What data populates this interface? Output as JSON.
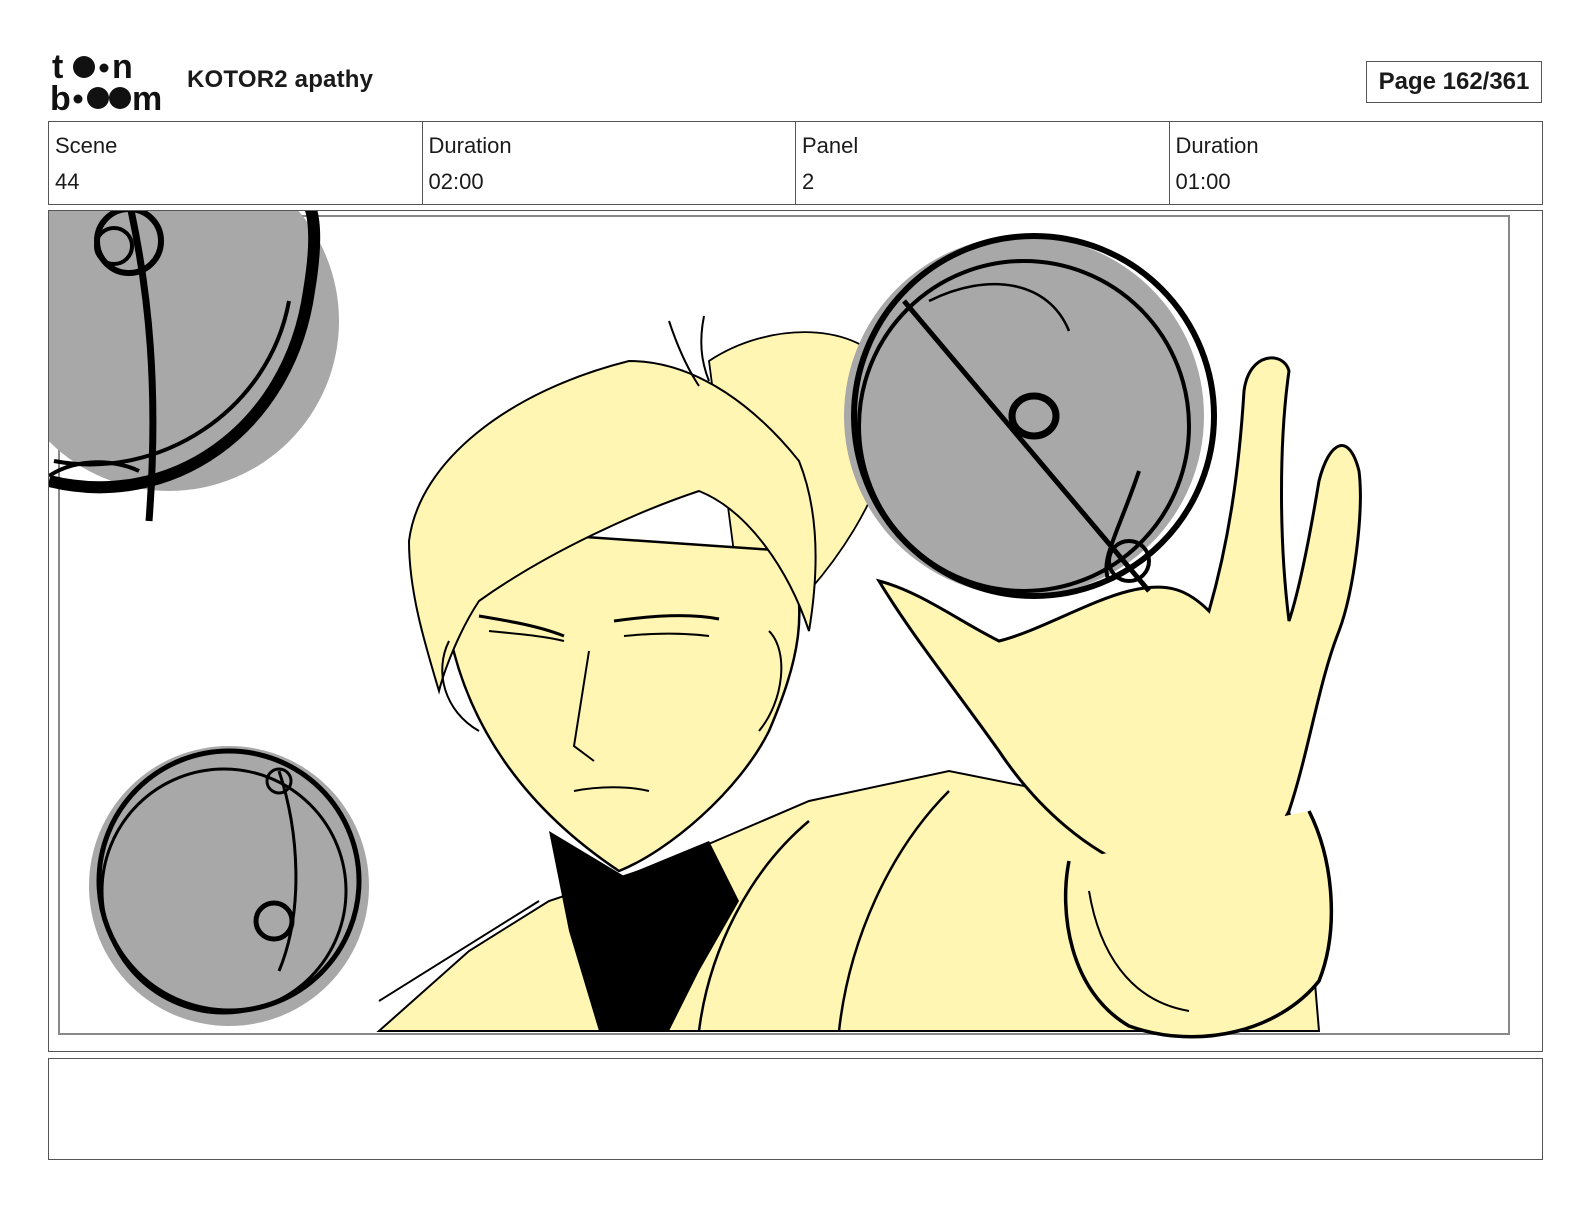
{
  "header": {
    "logo_text": "toon boom",
    "project_title": "KOTOR2 apathy",
    "page_label": "Page 162/361"
  },
  "info": {
    "scene_label": "Scene",
    "scene_value": "44",
    "scene_duration_label": "Duration",
    "scene_duration_value": "02:00",
    "panel_label": "Panel",
    "panel_value": "2",
    "panel_duration_label": "Duration",
    "panel_duration_value": "01:00"
  },
  "notes": {
    "text": ""
  },
  "colors": {
    "skin_fill": "#fff6b3",
    "sphere_fill": "#a8a8a8",
    "ink": "#000000",
    "border": "#555555"
  }
}
